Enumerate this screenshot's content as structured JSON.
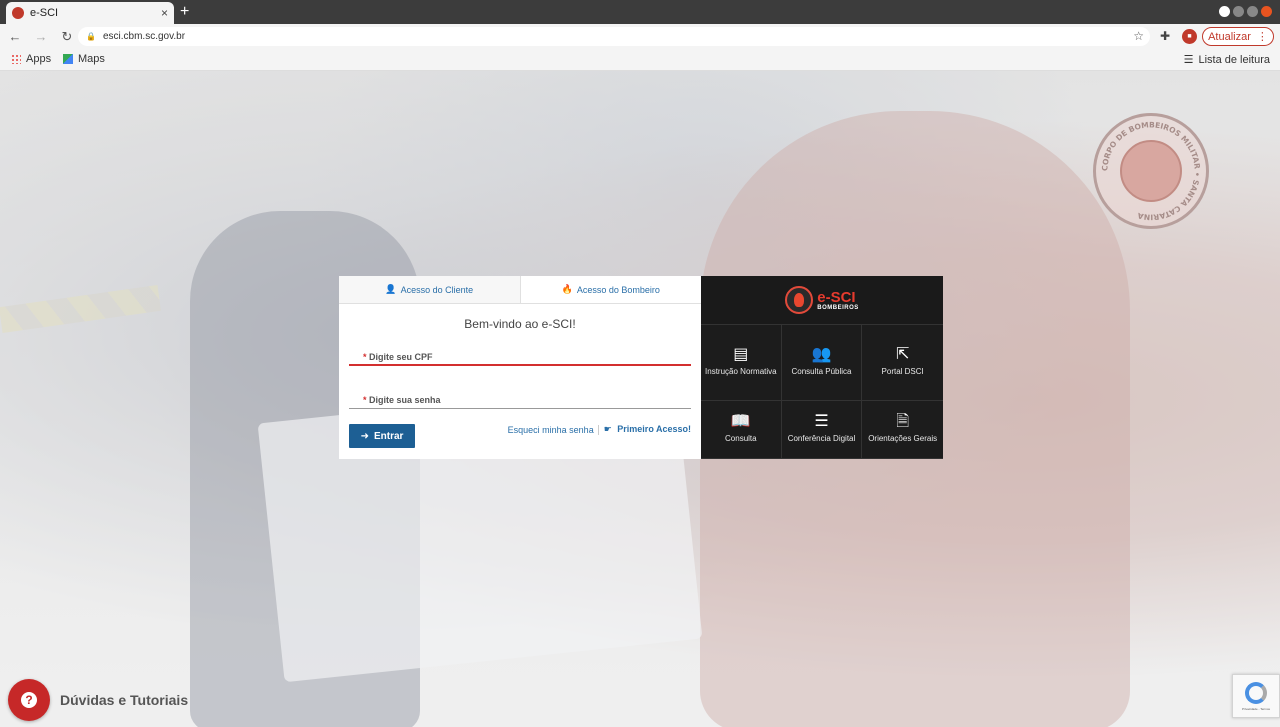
{
  "browser": {
    "tab_title": "e-SCI",
    "tab_close": "×",
    "new_tab": "+",
    "url": "esci.cbm.sc.gov.br",
    "update_label": "Atualizar",
    "update_menu": "⋮",
    "bookmarks": [
      {
        "label": "Apps"
      },
      {
        "label": "Maps"
      }
    ],
    "reading_list": "Lista de leitura"
  },
  "login": {
    "tab_client": "Acesso do Cliente",
    "tab_firefighter": "Acesso do Bombeiro",
    "welcome": "Bem-vindo ao e-SCI!",
    "cpf_label": "Digite seu CPF",
    "password_label": "Digite sua senha",
    "required_mark": "*",
    "submit": "Entrar",
    "forgot": "Esqueci minha senha",
    "first_access": "Primeiro Acesso!"
  },
  "panel": {
    "brand_main": "e-SCI",
    "brand_sub": "BOMBEIROS",
    "items": [
      {
        "label": "Instrução Normativa",
        "icon": "book-icon"
      },
      {
        "label": "Consulta Pública",
        "icon": "users-icon"
      },
      {
        "label": "Portal DSCI",
        "icon": "external-link-icon"
      },
      {
        "label": "Consulta",
        "icon": "open-book-icon"
      },
      {
        "label": "Conferência Digital",
        "icon": "checklist-icon"
      },
      {
        "label": "Orientações Gerais",
        "icon": "document-icon"
      }
    ]
  },
  "seal": {
    "text": "CORPO DE BOMBEIROS MILITAR • SANTA CATARINA"
  },
  "help": {
    "label": "Dúvidas e Tutoriais"
  },
  "recaptcha": {
    "text": "Privacidade - Termos"
  },
  "colors": {
    "primary": "#1d5f94",
    "accent": "#d32f2f",
    "panel_bg": "#1a1a1a",
    "link": "#2a6fa8"
  }
}
